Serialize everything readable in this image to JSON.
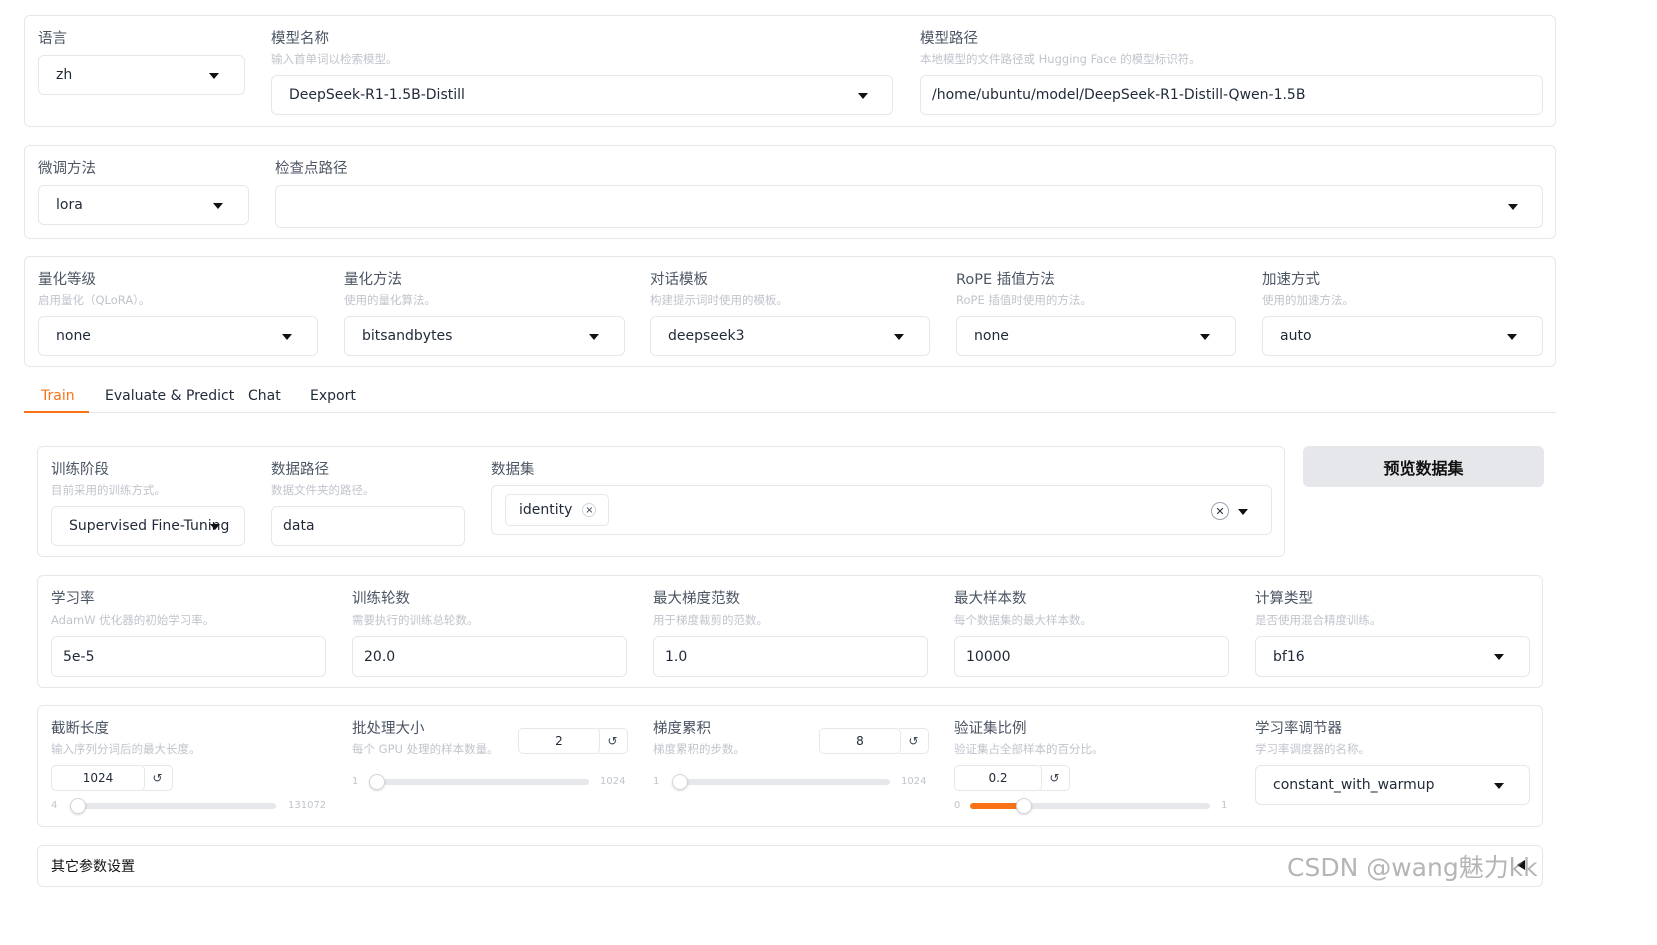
{
  "row1": {
    "language": {
      "label": "语言",
      "value": "zh"
    },
    "model_name": {
      "label": "模型名称",
      "hint": "输入首单词以检索模型。",
      "value": "DeepSeek-R1-1.5B-Distill"
    },
    "model_path": {
      "label": "模型路径",
      "hint": "本地模型的文件路径或 Hugging Face 的模型标识符。",
      "value": "/home/ubuntu/model/DeepSeek-R1-Distill-Qwen-1.5B"
    }
  },
  "row2": {
    "finetune": {
      "label": "微调方法",
      "value": "lora"
    },
    "checkpoint": {
      "label": "检查点路径",
      "value": ""
    }
  },
  "row3": {
    "quant_bit": {
      "label": "量化等级",
      "hint": "启用量化（QLoRA）。",
      "value": "none"
    },
    "quant_method": {
      "label": "量化方法",
      "hint": "使用的量化算法。",
      "value": "bitsandbytes"
    },
    "template": {
      "label": "对话模板",
      "hint": "构建提示词时使用的模板。",
      "value": "deepseek3"
    },
    "rope": {
      "label": "RoPE 插值方法",
      "hint": "RoPE 插值时使用的方法。",
      "value": "none"
    },
    "booster": {
      "label": "加速方式",
      "hint": "使用的加速方法。",
      "value": "auto"
    }
  },
  "tabs": [
    "Train",
    "Evaluate & Predict",
    "Chat",
    "Export"
  ],
  "train": {
    "stage": {
      "label": "训练阶段",
      "hint": "目前采用的训练方式。",
      "value": "Supervised Fine-Tuning"
    },
    "dataset_dir": {
      "label": "数据路径",
      "hint": "数据文件夹的路径。",
      "value": "data"
    },
    "dataset": {
      "label": "数据集",
      "tag": "identity",
      "tag_close": "×",
      "clear": "✕"
    },
    "preview_button": "预览数据集",
    "lr": {
      "label": "学习率",
      "hint": "AdamW 优化器的初始学习率。",
      "value": "5e-5"
    },
    "epochs": {
      "label": "训练轮数",
      "hint": "需要执行的训练总轮数。",
      "value": "20.0"
    },
    "max_grad_norm": {
      "label": "最大梯度范数",
      "hint": "用于梯度裁剪的范数。",
      "value": "1.0"
    },
    "max_samples": {
      "label": "最大样本数",
      "hint": "每个数据集的最大样本数。",
      "value": "10000"
    },
    "compute_type": {
      "label": "计算类型",
      "hint": "是否使用混合精度训练。",
      "value": "bf16"
    },
    "cutoff_len": {
      "label": "截断长度",
      "hint": "输入序列分词后的最大长度。",
      "value": "1024",
      "min": "4",
      "max": "131072",
      "fraction": 0.0078
    },
    "batch_size": {
      "label": "批处理大小",
      "hint": "每个 GPU 处理的样本数量。",
      "value": "2",
      "min": "1",
      "max": "1024",
      "fraction": 0.001
    },
    "grad_accum": {
      "label": "梯度累积",
      "hint": "梯度累积的步数。",
      "value": "8",
      "min": "1",
      "max": "1024",
      "fraction": 0.007
    },
    "val_size": {
      "label": "验证集比例",
      "hint": "验证集占全部样本的百分比。",
      "value": "0.2",
      "min": "0",
      "max": "1",
      "fraction": 0.2
    },
    "lr_scheduler": {
      "label": "学习率调节器",
      "hint": "学习率调度器的名称。",
      "value": "constant_with_warmup"
    },
    "reset_icon": "↺",
    "extra_settings": "其它参数设置"
  },
  "watermark": "CSDN @wang魅力kk",
  "colors": {
    "accent": "#f97316",
    "border": "#e5e7eb",
    "hint": "#c0c4cc",
    "button_bg": "#e5e7eb"
  }
}
